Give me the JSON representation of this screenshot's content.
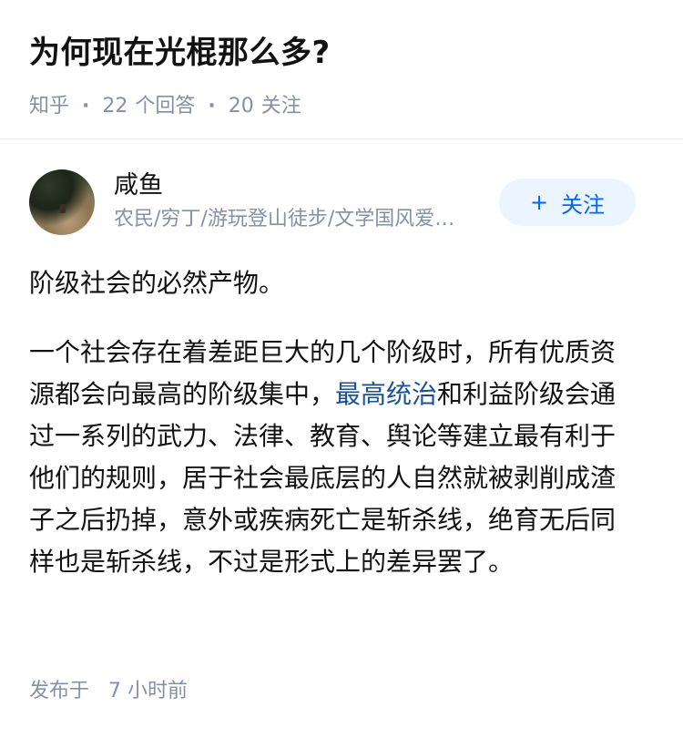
{
  "question": {
    "title": "为何现在光棍那么多?",
    "source": "知乎",
    "answers_count": "22",
    "answers_label": "个回答",
    "follows_count": "20",
    "follows_label": "关注"
  },
  "author": {
    "name": "咸鱼",
    "bio": "农民/穷丁/游玩登山徒步/文学国风爱好者",
    "follow_label": "关注",
    "follow_icon": "+"
  },
  "answer": {
    "paragraph1": "阶级社会的必然产物。",
    "paragraph2_part1": "一个社会存在着差距巨大的几个阶级时，所有优质资源都会向最高的阶级集中，",
    "paragraph2_link": "最高统治",
    "paragraph2_part2": "和利益阶级会通过一系列的武力、法律、教育、舆论等建立最有利于他们的规则，居于社会最底层的人自然就被剥削成渣子之后扔掉，意外或疾病死亡是斩杀线，绝育无后同样也是斩杀线，不过是形式上的差异罢了。"
  },
  "footer": {
    "published_label": "发布于",
    "published_time": "7 小时前"
  },
  "colors": {
    "link": "#175199",
    "muted": "#8590a6",
    "follow_bg": "#ebf5ff",
    "follow_text": "#0066ff"
  }
}
